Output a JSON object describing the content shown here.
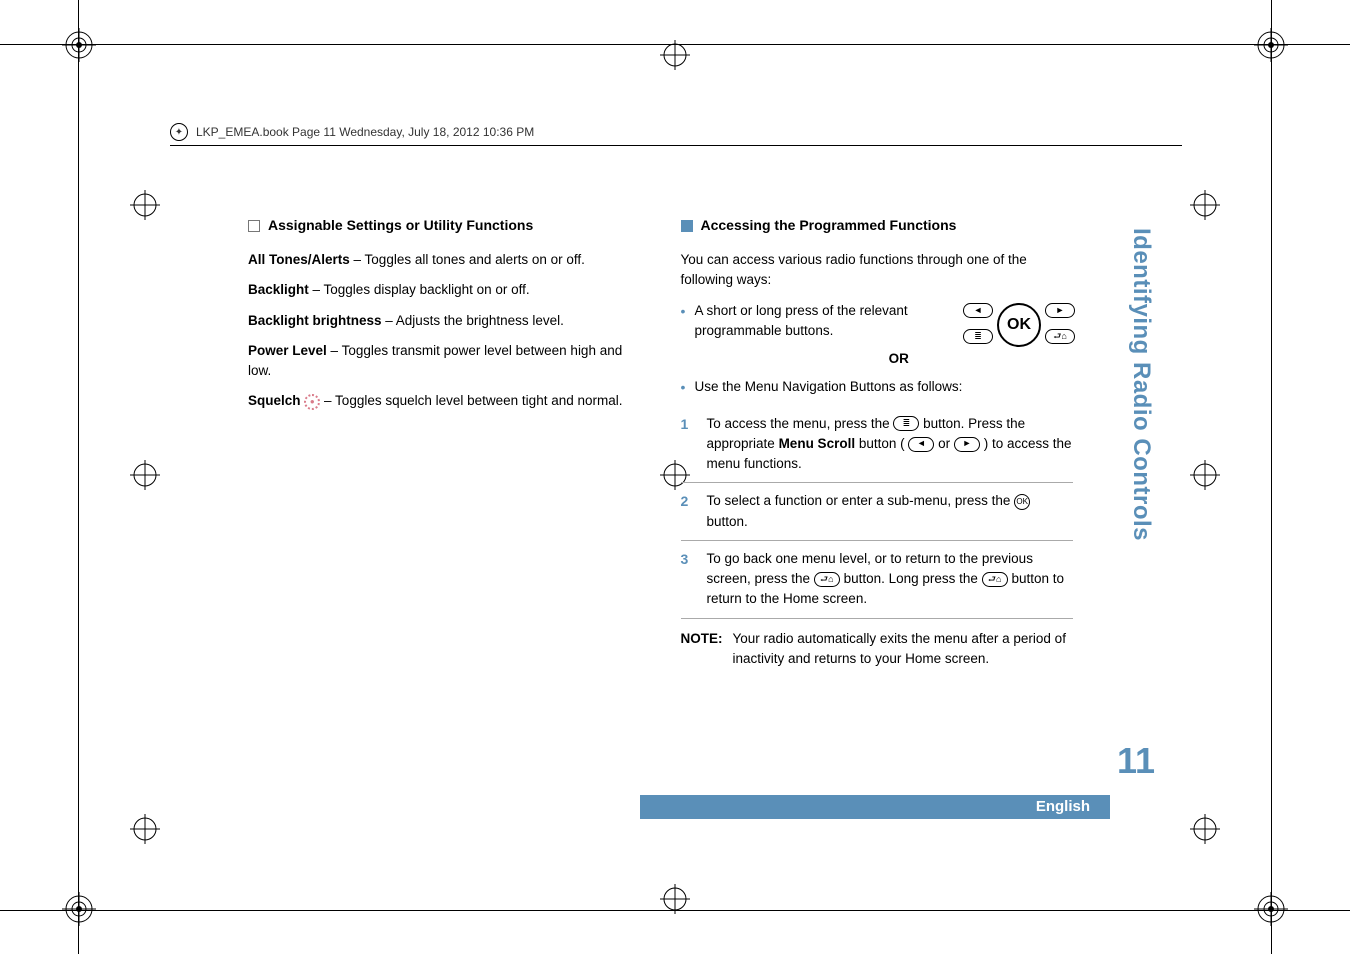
{
  "header_line": "LKP_EMEA.book  Page 11  Wednesday, July 18, 2012  10:36 PM",
  "left": {
    "heading": "Assignable Settings or Utility Functions",
    "items": [
      {
        "term": "All Tones/Alerts",
        "desc": " – Toggles all tones and alerts on or off."
      },
      {
        "term": "Backlight",
        "desc": " – Toggles display backlight on or off."
      },
      {
        "term": "Backlight brightness",
        "desc": " – Adjusts the brightness level."
      },
      {
        "term": "Power Level",
        "desc": " – Toggles transmit power level between high and low."
      }
    ],
    "squelch": {
      "term": "Squelch",
      "desc": " – Toggles squelch level between tight and normal."
    }
  },
  "right": {
    "heading": "Accessing the Programmed Functions",
    "intro": "You can access various radio functions through one of the following ways:",
    "bullet1": "A short or long press of the relevant programmable buttons.",
    "or": "OR",
    "bullet2": "Use the Menu Navigation Buttons as follows:",
    "cluster": {
      "ok": "OK",
      "left": "◄",
      "right": "►",
      "menu": "≣",
      "back": "⮐⌂"
    },
    "steps": [
      {
        "num": "1",
        "pre": "To access the menu, press the ",
        "btn1": "≣",
        "mid1": " button. Press the appropriate ",
        "bold": "Menu Scroll",
        "mid2": " button (",
        "scrollL": "◄",
        "or": "or",
        "scrollR": "►",
        "post": ") to access the menu functions."
      },
      {
        "num": "2",
        "pre": "To select a function or enter a sub-menu, press the ",
        "btnok": "OK",
        "post": " button."
      },
      {
        "num": "3",
        "pre": "To go back one menu level, or to return to the previous screen, press the ",
        "btn1": "⮐⌂",
        "mid": " button. Long press the ",
        "btn2": "⮐⌂",
        "post": " button to return to the Home screen."
      }
    ],
    "note_label": "NOTE:",
    "note_text": "Your radio automatically exits the menu after a period of inactivity and returns to your Home screen."
  },
  "sidebar": "Identifying Radio Controls",
  "page_number": "11",
  "language": "English"
}
